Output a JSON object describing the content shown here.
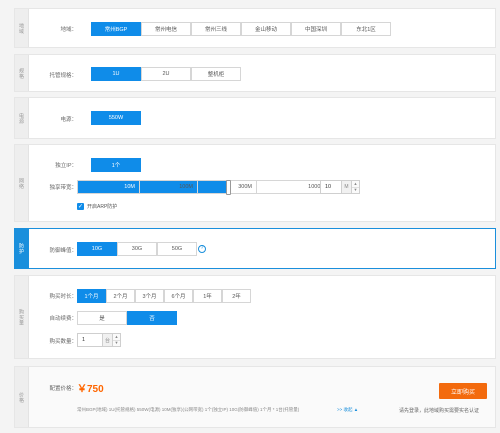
{
  "region": {
    "tab": "地域",
    "label": "地域：",
    "options": [
      "常州BGP",
      "常州电信",
      "常州三线",
      "金山移动",
      "中国深圳",
      "东北1区"
    ],
    "selected": 0
  },
  "spec": {
    "tab": "规格",
    "label": "托管规格：",
    "options": [
      "1U",
      "2U",
      "整机柜"
    ],
    "selected": 0
  },
  "power": {
    "tab": "电源",
    "label": "电源：",
    "value": "550W"
  },
  "network": {
    "tab": "网络",
    "ip_label": "独立IP：",
    "ip_value": "1个",
    "bw_label": "独享带宽：",
    "bw_ticks": [
      "10M",
      "100M",
      "300M",
      "1000M"
    ],
    "bw_fill_fraction": 0.143,
    "bw_input": "10",
    "bw_unit": "M",
    "arp_label": "开启ARP防护",
    "arp_checked": true
  },
  "defense": {
    "tab": "防护",
    "label": "防御峰值：",
    "options": [
      "10G",
      "30G",
      "50G"
    ],
    "selected": 0,
    "help_icon": "?"
  },
  "purchase": {
    "tab": "购买量",
    "duration_label": "购买时长：",
    "durations": [
      "1个月",
      "2个月",
      "3个月",
      "6个月",
      "1年",
      "2年"
    ],
    "duration_selected": 0,
    "renew_label": "自动续费：",
    "renew_options": [
      "是",
      "否"
    ],
    "renew_selected": 1,
    "qty_label": "购买数量：",
    "qty_value": "1",
    "qty_unit": "台"
  },
  "price": {
    "tab": "价格",
    "label": "配置价格：",
    "value": "￥750",
    "summary": "常州BGP(地域)   1U(托管规格)   550W(电源)   10M(独享)(公网带宽)   1个(独立IP)   10G(防御峰值)   1个月 * 1台(托管量)",
    "collapse_link": ">> 收起 ▲",
    "buy_button": "立即购买",
    "note": "请先登录，此地域购买需要实名认证"
  },
  "colors": {
    "accent": "#0f8ce9",
    "price": "#ff6600",
    "buy": "#f36a0d"
  }
}
